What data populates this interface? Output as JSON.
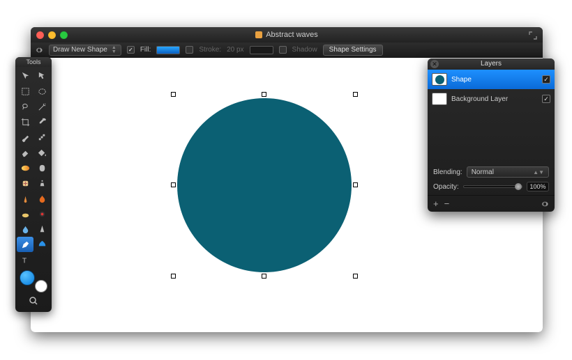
{
  "window": {
    "title": "Abstract waves"
  },
  "optbar": {
    "mode": "Draw New Shape",
    "fill_label": "Fill:",
    "stroke_label": "Stroke:",
    "stroke_width": "20 px",
    "shadow_label": "Shadow",
    "shape_settings": "Shape Settings",
    "fill_color": "#1f92e8",
    "stroke_color": "#1a1a1a"
  },
  "tools_panel": {
    "title": "Tools"
  },
  "canvas": {
    "shape_fill": "#0b6073"
  },
  "layers_panel": {
    "title": "Layers",
    "items": [
      {
        "name": "Shape",
        "selected": true,
        "visible": true,
        "thumb_fill": "#0b6073"
      },
      {
        "name": "Background Layer",
        "selected": false,
        "visible": true,
        "thumb_fill": "#ffffff"
      }
    ],
    "blending_label": "Blending:",
    "blending_value": "Normal",
    "opacity_label": "Opacity:",
    "opacity_value": "100%"
  }
}
